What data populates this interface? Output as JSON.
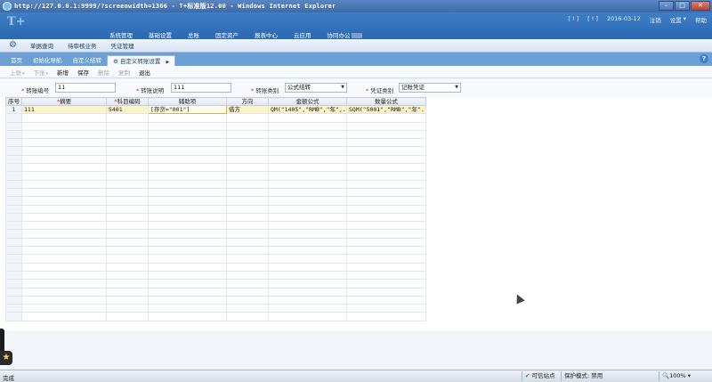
{
  "window": {
    "title": "http://127.0.0.1:9999/?screenwidth=1366 - T+标准版12.00 - Windows Internet Explorer"
  },
  "header": {
    "logo": "T+",
    "topbar": {
      "ticket1": "[ ! ]",
      "ticket2": "[ ! ]",
      "date": "2016-03-12",
      "logout": "注销",
      "settings": "设置",
      "help": "帮助"
    },
    "nav": [
      "系统管理",
      "基础设置",
      "总账",
      "固定资产",
      "报表中心",
      "云应用",
      "协同办公"
    ]
  },
  "funcbar": {
    "items": [
      "单据查询",
      "待审核业务",
      "凭证管理"
    ]
  },
  "tabs": {
    "items": [
      "首页",
      "初始化导航",
      "自定义结转"
    ],
    "active": "自定义转账设置"
  },
  "toolbar": {
    "prev": "上张",
    "next": "下张",
    "add": "新增",
    "save": "保存",
    "delete": "删除",
    "copy": "复制",
    "exit": "退出"
  },
  "form": {
    "code_label": "转账编号",
    "code_value": "11",
    "desc_label": "转账说明",
    "desc_value": "111",
    "type_label": "转账类别",
    "type_value": "公式结转",
    "voucher_label": "凭证类别",
    "voucher_value": "记账凭证"
  },
  "grid": {
    "headers": [
      "序号",
      "摘要",
      "科目编码",
      "辅助项",
      "方向",
      "金额公式",
      "数量公式"
    ],
    "rows": [
      [
        "1",
        "111",
        "5401",
        "[存货=\"001\"]",
        "借方",
        "QM(\"1405\",\"RMB\",\"年\",...",
        "SQM(\"5001\",\"RMB\",\"年\"..."
      ]
    ]
  },
  "statusbar": {
    "done": "完成",
    "zone": "可信站点",
    "protect": "保护模式: 禁用",
    "zoom": "100%"
  }
}
